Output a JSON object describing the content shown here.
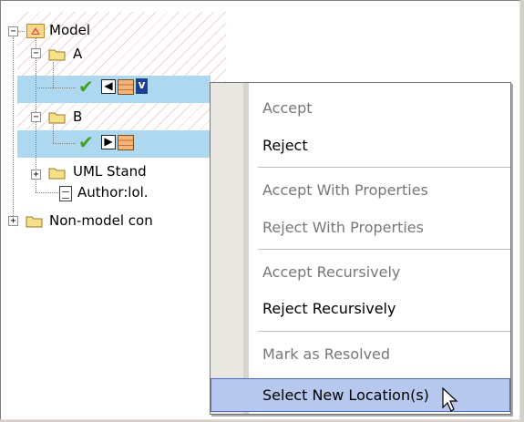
{
  "tree": {
    "root_label": "Model",
    "node_a_label": "A",
    "node_b_label": "B",
    "node_uml_label": "UML Stand",
    "node_author_label": "Author:lol.",
    "node_nonmodel_label": "Non-model con",
    "badge_text": "v"
  },
  "context_menu": {
    "items": [
      {
        "label": "Accept",
        "enabled": false
      },
      {
        "label": "Reject",
        "enabled": true
      },
      {
        "label": "Accept With Properties",
        "enabled": false
      },
      {
        "label": "Reject With Properties",
        "enabled": false
      },
      {
        "label": "Accept Recursively",
        "enabled": false
      },
      {
        "label": "Reject Recursively",
        "enabled": true
      },
      {
        "label": "Mark as Resolved",
        "enabled": false
      },
      {
        "label": "Select New Location(s)",
        "enabled": true,
        "highlighted": true
      }
    ]
  },
  "colors": {
    "selection": "#add8f0",
    "menu_highlight": "#b6c8ee",
    "check_green": "#3fa51e"
  },
  "icons": [
    "model-icon",
    "folder-icon",
    "check-icon",
    "arrow-left-icon",
    "arrow-right-icon",
    "element-icon",
    "document-icon",
    "pointer-cursor"
  ]
}
